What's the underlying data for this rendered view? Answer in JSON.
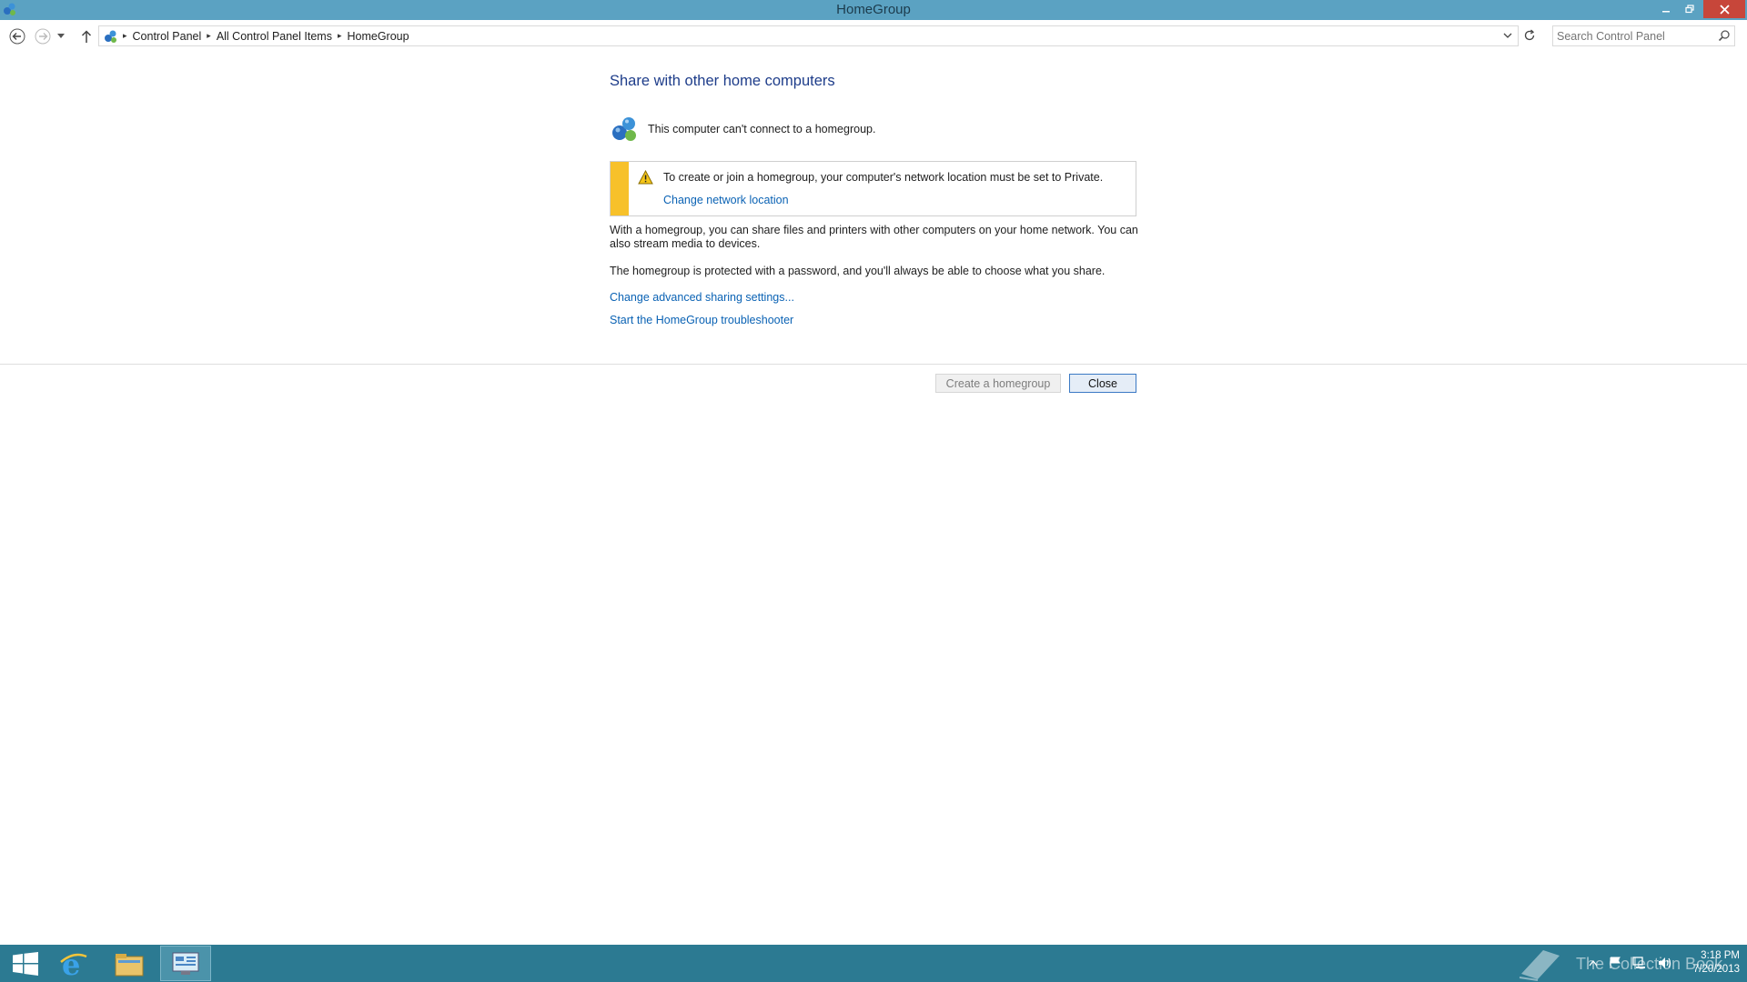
{
  "window": {
    "title": "HomeGroup",
    "icon": "homegroup-icon",
    "minimize_icon": "minimize-icon",
    "restore_icon": "restore-icon",
    "close_icon": "close-icon"
  },
  "nav": {
    "back_icon": "back-arrow-icon",
    "forward_icon": "forward-arrow-icon",
    "recent_icon": "chevron-down-icon",
    "up_icon": "up-arrow-icon",
    "breadcrumbs": [
      "Control Panel",
      "All Control Panel Items",
      "HomeGroup"
    ],
    "refresh_icon": "refresh-icon"
  },
  "search": {
    "placeholder": "Search Control Panel",
    "icon": "search-icon"
  },
  "content": {
    "heading": "Share with other home computers",
    "status_text": "This computer can't connect to a homegroup.",
    "warning": {
      "message": "To create or join a homegroup, your computer's network location must be set to Private.",
      "link": "Change network location"
    },
    "paragraph1": "With a homegroup, you can share files and printers with other computers on your home network. You can also stream media to devices.",
    "paragraph2": "The homegroup is protected with a password, and you'll always be able to choose what you share.",
    "link_advanced": "Change advanced sharing settings...",
    "link_troubleshooter": "Start the HomeGroup troubleshooter"
  },
  "buttons": {
    "create": "Create a homegroup",
    "close": "Close"
  },
  "taskbar": {
    "items": [
      "start-button",
      "internet-explorer",
      "file-explorer",
      "control-panel"
    ],
    "watermark": "The Collection Book",
    "time": "3:18 PM",
    "date": "7/20/2013"
  },
  "colors": {
    "title_bar": "#5ba2c2",
    "taskbar": "#2c7a92",
    "link": "#0a62b4",
    "warning_bar": "#f7c12a",
    "heading": "#1e3d8a"
  }
}
